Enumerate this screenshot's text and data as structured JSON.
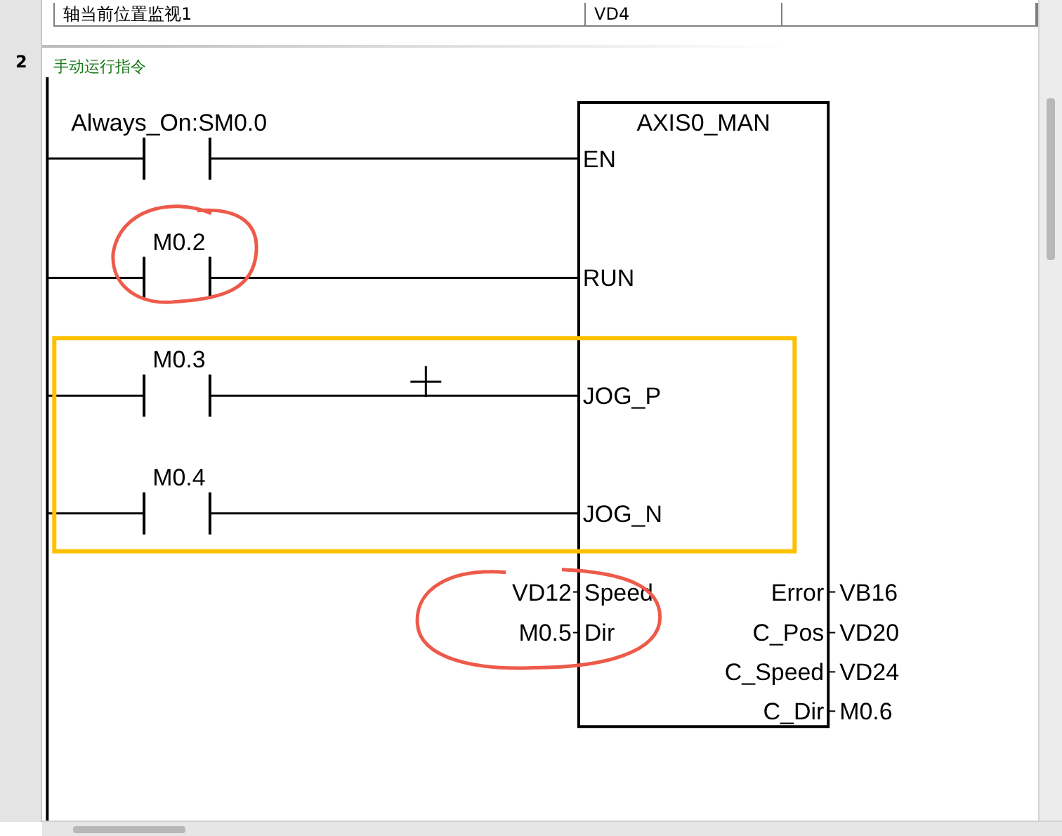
{
  "symbol_table": {
    "rows": [
      {
        "comment": "轴当前位置监视1",
        "address": "VD4"
      }
    ]
  },
  "network": {
    "number": "2",
    "title": "手动运行指令",
    "block": {
      "name": "AXIS0_MAN",
      "inputs": [
        {
          "pin": "EN",
          "contact": "Always_On:SM0.0"
        },
        {
          "pin": "RUN",
          "contact": "M0.2"
        },
        {
          "pin": "JOG_P",
          "contact": "M0.3"
        },
        {
          "pin": "JOG_N",
          "contact": "M0.4"
        }
      ],
      "parameters": [
        {
          "operand": "VD12",
          "pin": "Speed"
        },
        {
          "operand": "M0.5",
          "pin": "Dir"
        }
      ],
      "outputs": [
        {
          "pin": "Error",
          "operand": "VB16"
        },
        {
          "pin": "C_Pos",
          "operand": "VD20"
        },
        {
          "pin": "C_Speed",
          "operand": "VD24"
        },
        {
          "pin": "C_Dir",
          "operand": "M0.6"
        }
      ]
    }
  }
}
